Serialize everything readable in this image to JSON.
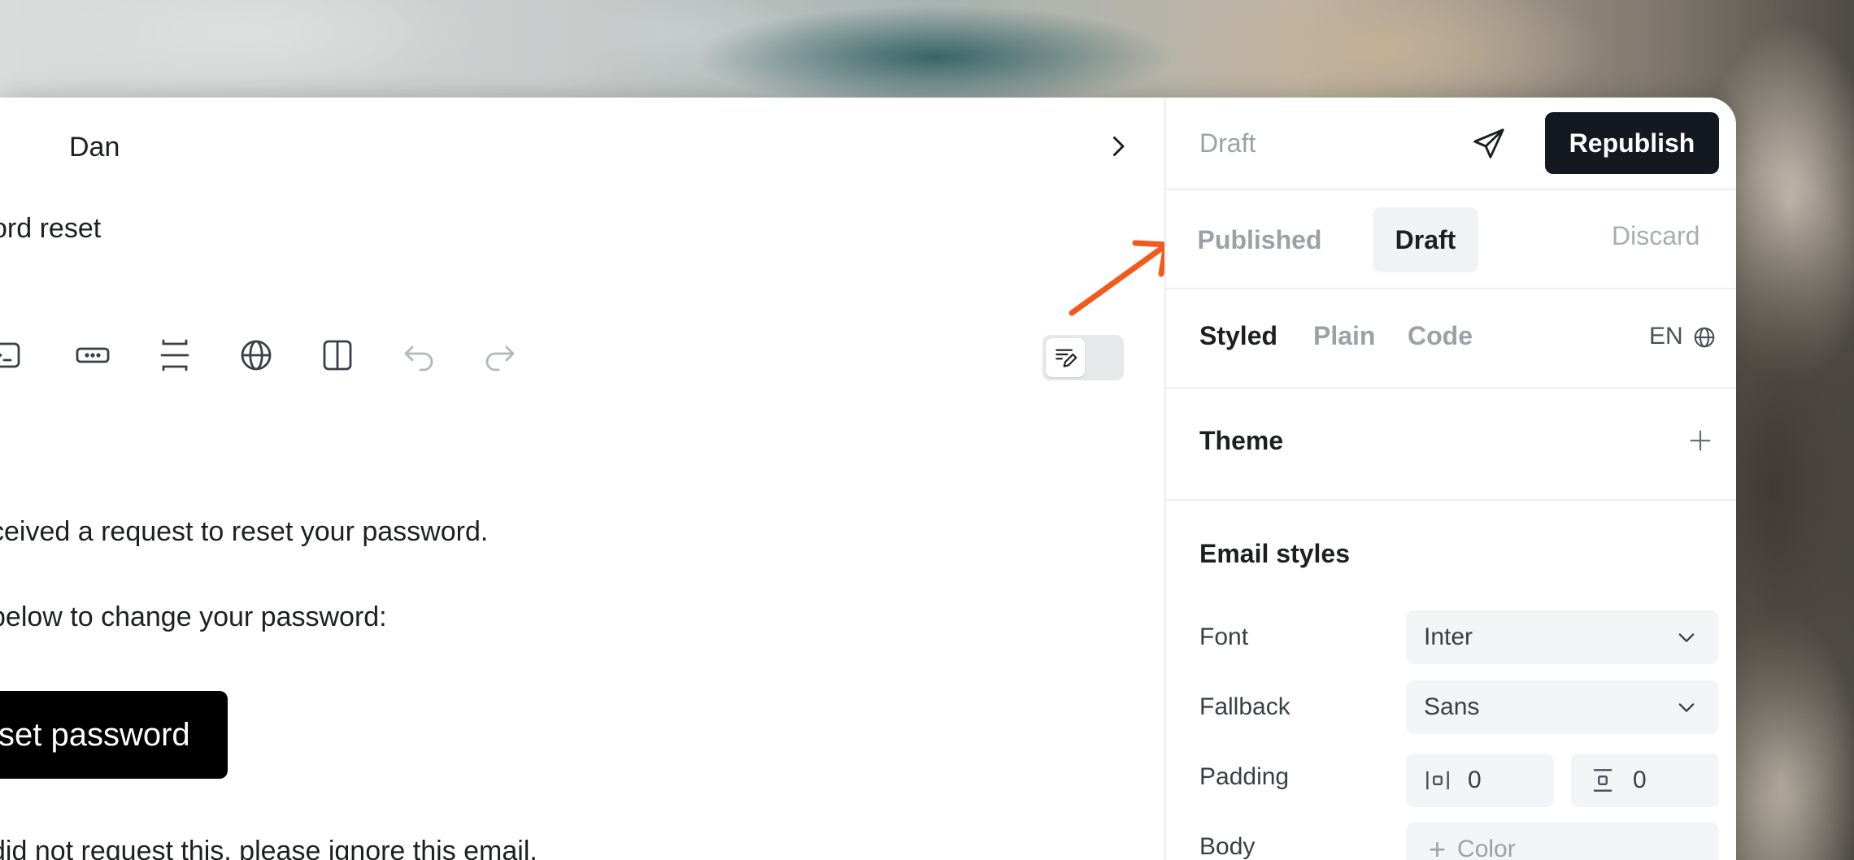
{
  "editor": {
    "recipient": "Dan",
    "subject": "ord reset",
    "toolbar_icons": [
      "terminal-icon",
      "button-icon",
      "spacer-icon",
      "globe-icon",
      "columns-icon",
      "undo-icon",
      "redo-icon"
    ],
    "body_lines": [
      "ceived a request to reset your password.",
      "below to change your password:",
      "did not request this, please ignore this email."
    ],
    "cta_label": "set password"
  },
  "panel": {
    "status": "Draft",
    "republish_label": "Republish",
    "version_tabs": {
      "published": "Published",
      "draft": "Draft"
    },
    "discard_label": "Discard",
    "mode_tabs": {
      "styled": "Styled",
      "plain": "Plain",
      "code": "Code"
    },
    "language": "EN",
    "theme_title": "Theme",
    "email_styles_title": "Email styles",
    "fields": {
      "font_label": "Font",
      "font_value": "Inter",
      "fallback_label": "Fallback",
      "fallback_value": "Sans",
      "padding_label": "Padding",
      "padding_x": "0",
      "padding_y": "0",
      "body_label": "Body",
      "body_color_label": "Color"
    }
  },
  "colors": {
    "accent_arrow": "#f25a1c",
    "primary_button": "#141821",
    "cta_button": "#000000"
  }
}
